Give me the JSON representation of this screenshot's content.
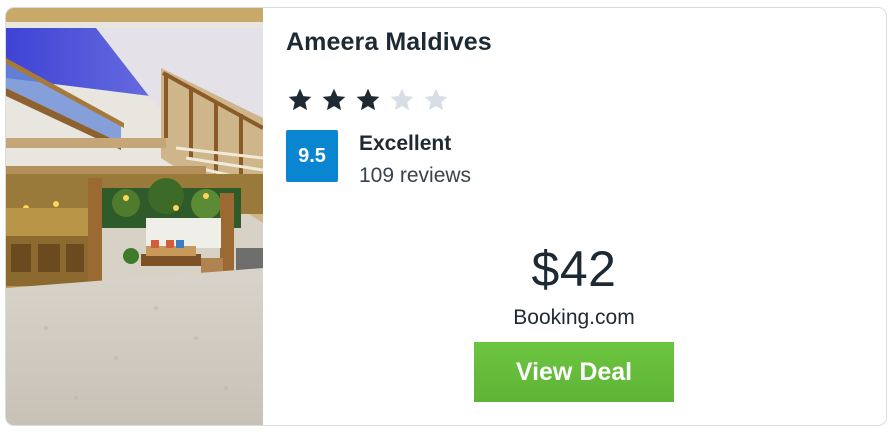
{
  "hotel": {
    "name": "Ameera Maldives",
    "stars": {
      "filled": 3,
      "total": 5
    },
    "rating": {
      "score": "9.5",
      "label": "Excellent",
      "reviews": "109 reviews"
    },
    "price": "$42",
    "provider": "Booking.com",
    "cta_label": "View Deal",
    "photo_icon": "hotel-lobby-photo"
  },
  "colors": {
    "star_filled": "#1f2a33",
    "star_empty": "#d7dee6",
    "score_badge": "#0a85d1",
    "cta_button": "#64bb3a",
    "text": "#1e2a33"
  }
}
